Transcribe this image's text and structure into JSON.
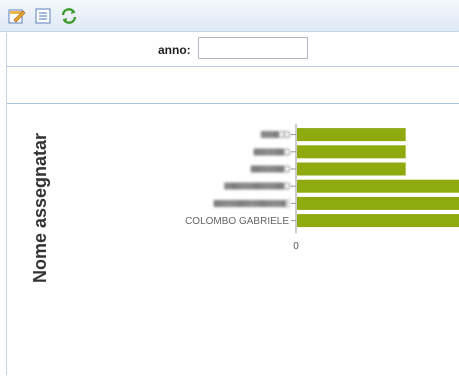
{
  "toolbar": {
    "icons": [
      "edit-icon",
      "list-icon",
      "refresh-icon"
    ]
  },
  "filter": {
    "label": "anno:",
    "value": ""
  },
  "chart_data": {
    "type": "bar",
    "orientation": "horizontal",
    "ylabel": "Nome assegnatar",
    "categories": [
      "IIIIIIIIIIIIIIIIIICO",
      "IIIIIIIIIIIIIIIIIIIIIIIIIIIIIIIO",
      "IIIIIIIIIIIIIIIIIIIIIIIIIIIIIIIIIIO",
      "IIIIIIIIIIIIIIIIIIIIIIIIIIIIIIIIIIIIIIIIIIIIIIIIIIIIIIIIIIIIIO",
      "IIIIIIIIIIIIIIIIIIIIIIIIIIIIIIIIIIIIIIIIIIIIIIIIIIIIIIIIIIIIIIIIIIIIIIIIIE",
      "COLOMBO GABRIELE"
    ],
    "blurred": [
      true,
      true,
      true,
      true,
      true,
      false
    ],
    "values": [
      1,
      1,
      1,
      2,
      2,
      2
    ],
    "xlim": [
      0,
      1.5
    ],
    "x_ticks": [
      "0"
    ],
    "bar_color": "#8faa0e"
  }
}
